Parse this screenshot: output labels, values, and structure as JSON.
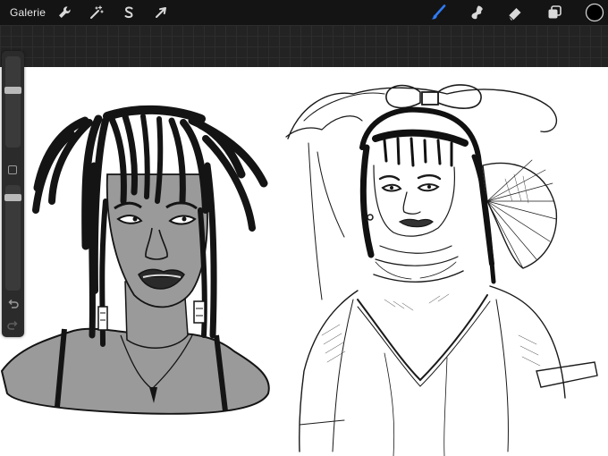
{
  "toolbar": {
    "gallery_label": "Galerie",
    "left_tools": [
      {
        "name": "actions",
        "icon": "wrench-icon"
      },
      {
        "name": "adjustments",
        "icon": "magic-wand-icon"
      },
      {
        "name": "selection",
        "icon": "selection-s-icon"
      },
      {
        "name": "transform",
        "icon": "arrow-cursor-icon"
      }
    ],
    "right_tools": [
      {
        "name": "brush",
        "icon": "brush-icon",
        "active": true
      },
      {
        "name": "smudge",
        "icon": "smudge-icon"
      },
      {
        "name": "eraser",
        "icon": "eraser-icon"
      },
      {
        "name": "layers",
        "icon": "layers-icon"
      },
      {
        "name": "color",
        "icon": "color-swatch",
        "value": "#000000"
      }
    ]
  },
  "colors": {
    "toolbar_bg": "#141414",
    "accent_active": "#2f7bf5",
    "canvas_bg": "#ffffff",
    "ink": "#141414",
    "skin_tone_gray": "#9a9a9a"
  },
  "sidebar": {
    "brush_size_level": 0.8,
    "opacity_level": 0.9,
    "modify_button": "square-icon",
    "undo": "undo-icon",
    "redo": "redo-icon"
  },
  "canvas": {
    "artwork": [
      {
        "subject": "portrait-dreadlocks-woman",
        "shading": "gray-fill"
      },
      {
        "subject": "sketch-woman-bonnet-lace-dress",
        "shading": "pencil-lines"
      }
    ]
  }
}
